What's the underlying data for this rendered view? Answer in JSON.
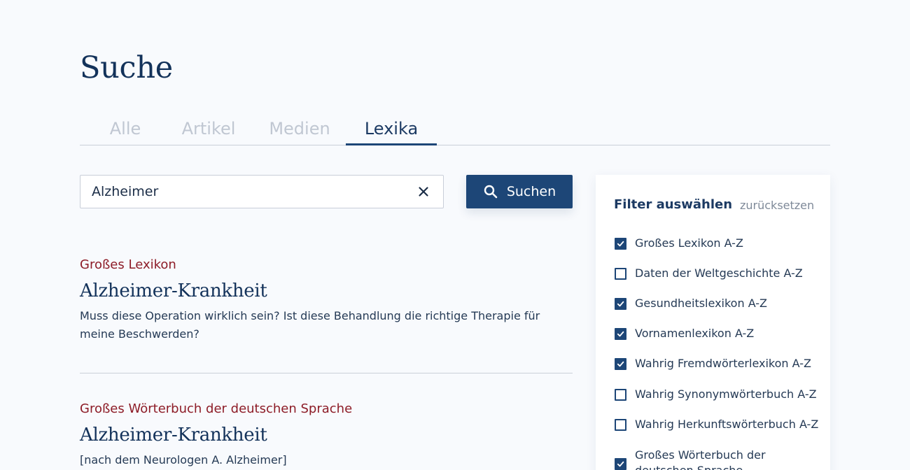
{
  "page": {
    "title": "Suche"
  },
  "tabs": [
    {
      "label": "Alle",
      "active": false
    },
    {
      "label": "Artikel",
      "active": false
    },
    {
      "label": "Medien",
      "active": false
    },
    {
      "label": "Lexika",
      "active": true
    }
  ],
  "search": {
    "value": "Alzheimer",
    "button_label": "Suchen"
  },
  "results": [
    {
      "source": "Großes Lexikon",
      "title": "Alzheimer-Krankheit",
      "text": "Muss diese Operation wirklich sein? Ist diese Behandlung die richtige Therapie für meine Beschwerden?"
    },
    {
      "source": "Großes Wörterbuch der deutschen Sprache",
      "title": "Alzheimer-Krankheit",
      "text": "[nach dem Neurologen A. Alzheimer]"
    }
  ],
  "filter": {
    "heading": "Filter auswählen",
    "reset_label": "zurücksetzen",
    "items": [
      {
        "label": "Großes Lexikon A-Z",
        "checked": true
      },
      {
        "label": "Daten der Weltgeschichte A-Z",
        "checked": false
      },
      {
        "label": "Gesundheitslexikon A-Z",
        "checked": true
      },
      {
        "label": "Vornamenlexikon A-Z",
        "checked": true
      },
      {
        "label": "Wahrig Fremdwörterlexikon A-Z",
        "checked": true
      },
      {
        "label": "Wahrig Synonymwörterbuch A-Z",
        "checked": false
      },
      {
        "label": "Wahrig Herkunftswörterbuch A-Z",
        "checked": false
      },
      {
        "label": "Großes Wörterbuch der deutschen Sprache",
        "checked": true
      }
    ]
  },
  "colors": {
    "primary": "#1d4677",
    "heading": "#13325a",
    "source_red": "#8d1c27",
    "tab_inactive": "#c0c7d2",
    "background": "#f8fafd"
  },
  "icons": {
    "clear": "close-icon",
    "search": "search-icon",
    "checkbox_checked": "checkmark-icon"
  }
}
